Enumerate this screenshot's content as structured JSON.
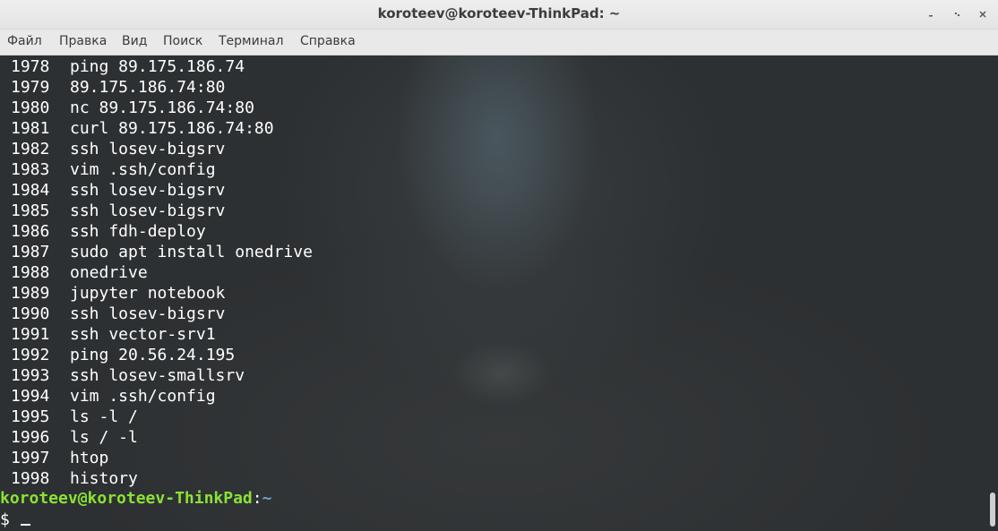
{
  "window": {
    "title": "koroteev@koroteev-ThinkPad: ~",
    "controls": [
      {
        "name": "minimize-button",
        "icon": "minimize-icon"
      },
      {
        "name": "maximize-button",
        "icon": "maximize-icon"
      },
      {
        "name": "close-button",
        "icon": "close-icon"
      }
    ]
  },
  "menu": {
    "items": [
      "Файл",
      "Правка",
      "Вид",
      "Поиск",
      "Терминал",
      "Справка"
    ]
  },
  "terminal": {
    "history": [
      {
        "num": "1978",
        "cmd": "ping 89.175.186.74"
      },
      {
        "num": "1979",
        "cmd": "89.175.186.74:80"
      },
      {
        "num": "1980",
        "cmd": "nc 89.175.186.74:80"
      },
      {
        "num": "1981",
        "cmd": "curl 89.175.186.74:80"
      },
      {
        "num": "1982",
        "cmd": "ssh losev-bigsrv"
      },
      {
        "num": "1983",
        "cmd": "vim .ssh/config"
      },
      {
        "num": "1984",
        "cmd": "ssh losev-bigsrv"
      },
      {
        "num": "1985",
        "cmd": "ssh losev-bigsrv"
      },
      {
        "num": "1986",
        "cmd": "ssh fdh-deploy"
      },
      {
        "num": "1987",
        "cmd": "sudo apt install onedrive"
      },
      {
        "num": "1988",
        "cmd": "onedrive"
      },
      {
        "num": "1989",
        "cmd": "jupyter notebook"
      },
      {
        "num": "1990",
        "cmd": "ssh losev-bigsrv"
      },
      {
        "num": "1991",
        "cmd": "ssh vector-srv1"
      },
      {
        "num": "1992",
        "cmd": "ping 20.56.24.195"
      },
      {
        "num": "1993",
        "cmd": "ssh losev-smallsrv"
      },
      {
        "num": "1994",
        "cmd": "vim .ssh/config"
      },
      {
        "num": "1995",
        "cmd": "ls -l /"
      },
      {
        "num": "1996",
        "cmd": "ls / -l"
      },
      {
        "num": "1997",
        "cmd": "htop"
      },
      {
        "num": "1998",
        "cmd": "history"
      }
    ],
    "prompt": {
      "user_host": "koroteev@koroteev-ThinkPad",
      "separator": ":",
      "path": "~",
      "symbol": "$"
    },
    "colors": {
      "prompt_user": "#8ae234",
      "prompt_path": "#729fcf",
      "text": "#ffffff"
    }
  }
}
